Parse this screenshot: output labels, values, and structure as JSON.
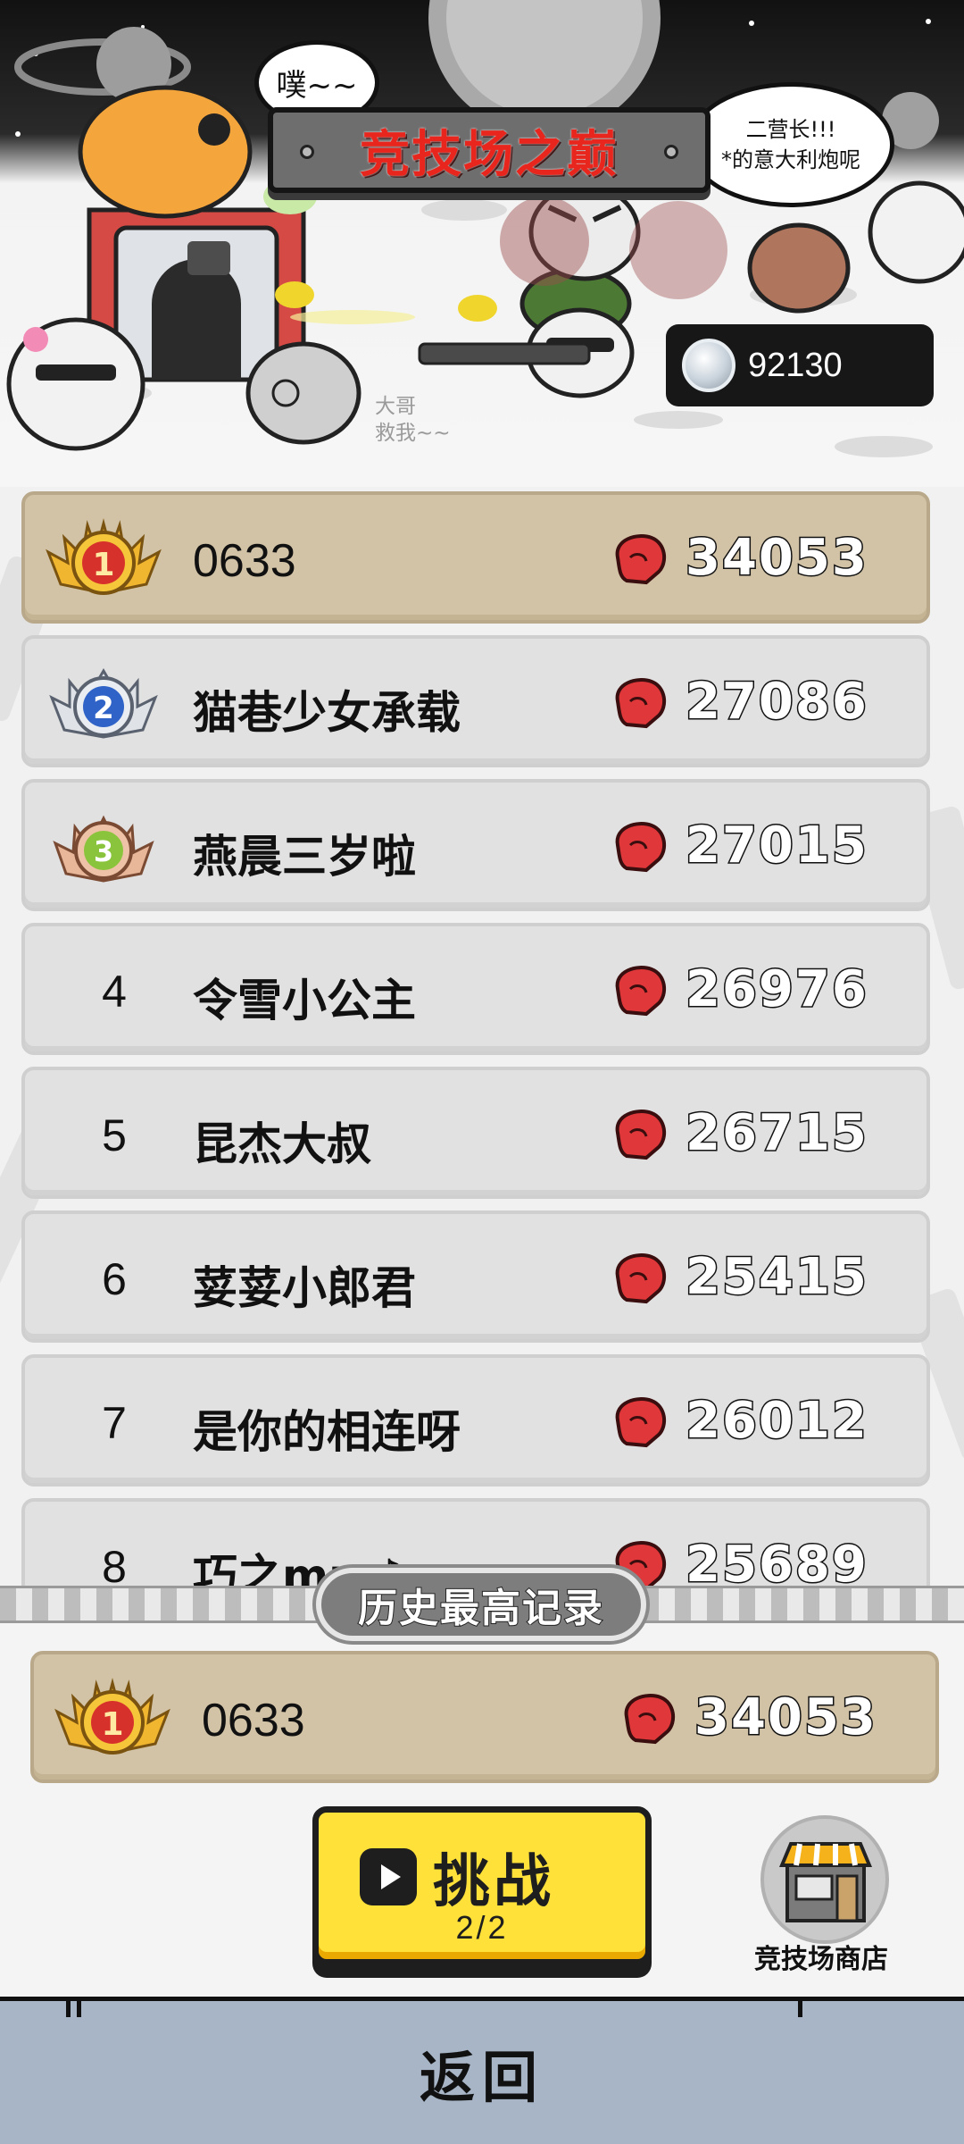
{
  "header": {
    "title": "竞技场之巅",
    "bubble_left": "噗~~",
    "bubble_right_lines": [
      "二营长!!!",
      "*的意大利炮呢"
    ],
    "caption_lines": [
      "大哥",
      "救我~~"
    ],
    "currency_icon": "silver-coin-icon",
    "currency_value": "92130"
  },
  "leaderboard": {
    "score_icon": "boxing-glove-icon",
    "rows": [
      {
        "rank": "1",
        "badge": "gold-medal",
        "name": "0633",
        "score": "34053"
      },
      {
        "rank": "2",
        "badge": "silver-medal",
        "name": "猫巷少女承载",
        "score": "27086"
      },
      {
        "rank": "3",
        "badge": "bronze-medal",
        "name": "燕晨三岁啦",
        "score": "27015"
      },
      {
        "rank": "4",
        "name": "令雪小公主",
        "score": "26976"
      },
      {
        "rank": "5",
        "name": "昆杰大叔",
        "score": "26715"
      },
      {
        "rank": "6",
        "name": "荽荽小郎君",
        "score": "25415"
      },
      {
        "rank": "7",
        "name": "是你的相连呀",
        "score": "26012"
      },
      {
        "rank": "8",
        "name": "巧之mm♪",
        "score": "25689"
      }
    ]
  },
  "record": {
    "label": "历史最高记录",
    "rank": "1",
    "name": "0633",
    "score": "34053"
  },
  "actions": {
    "challenge_label": "挑战",
    "challenge_count": "2/2",
    "shop_label": "竞技场商店",
    "back_label": "返回"
  },
  "colors": {
    "title_red": "#e8261d",
    "gold_row": "#d2c3a6",
    "row_gray": "#e1e1e1",
    "challenge_yellow": "#ffe13a",
    "bottom_bar": "#a7b5c6"
  }
}
